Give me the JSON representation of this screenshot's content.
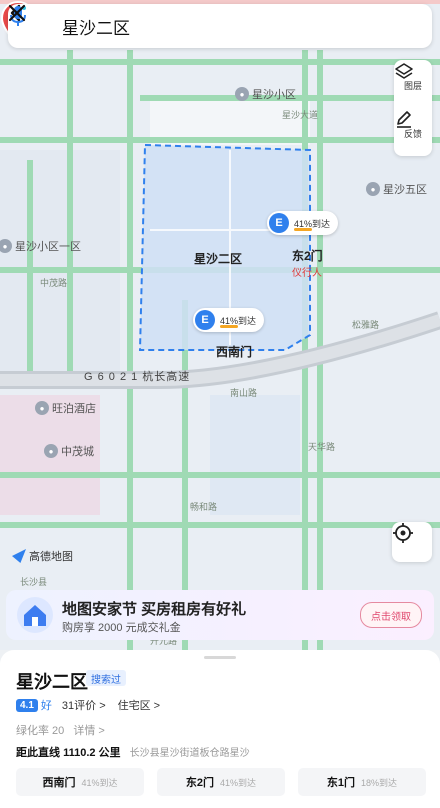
{
  "search": {
    "query": "星沙二区"
  },
  "tools": {
    "layers_label": "图层",
    "feedback_label": "反馈"
  },
  "map_labels": {
    "xingsha_xiaoqu": "星沙小区",
    "xingsha_1qu": "星沙小区一区",
    "xingsha_5qu": "星沙五区",
    "wangpo_hotel": "旺泊酒店",
    "zhongmao_city": "中茂城",
    "highway": "G 6 0 2 1 杭长高速",
    "gate_west_south": "西南门",
    "gate_east2": "东2门",
    "guards": "仪行人"
  },
  "road_labels": [
    "中茂路",
    "松雅路",
    "星沙大道",
    "南山路",
    "天华路",
    "畅和路",
    "开元路",
    "长沙县"
  ],
  "pin": {
    "label": "星沙二区"
  },
  "gate_cards": [
    {
      "pct": "41%到达"
    },
    {
      "pct": "41%到达"
    }
  ],
  "logo": {
    "text": "高德地图"
  },
  "banner": {
    "title": "地图安家节 买房租房有好礼",
    "subtitle": "购房享 2000 元成交礼金",
    "cta": "点击领取"
  },
  "place": {
    "name": "星沙二区",
    "searched": "搜索过",
    "score": "4.1",
    "score_text": "好",
    "reviews": "31评价 >",
    "category": "住宅区 >",
    "green_rate": "绿化率 20",
    "detail": "详情 >",
    "distance_label": "距此直线",
    "distance": "1110.2 公里",
    "address": "长沙县星沙街道板仓路星沙"
  },
  "gates": [
    {
      "name": "西南门",
      "pct": "41%到达"
    },
    {
      "name": "东2门",
      "pct": "41%到达"
    },
    {
      "name": "东1门",
      "pct": "18%到达"
    }
  ],
  "colors": {
    "accent": "#2f80ed",
    "road": "#8fd6a8",
    "highway": "#c8cdd4",
    "area": "#cfe0f7",
    "pin": "#e84a4a"
  }
}
